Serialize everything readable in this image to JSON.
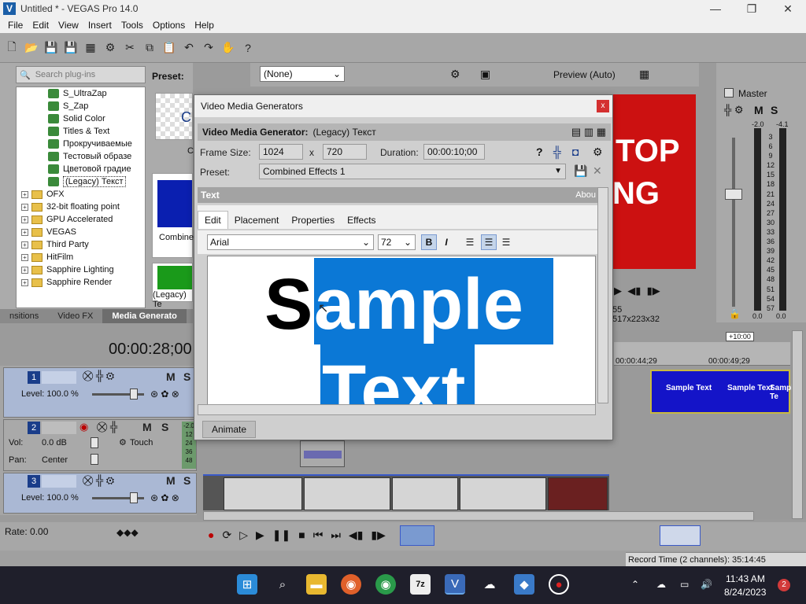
{
  "window": {
    "title": "Untitled * - VEGAS Pro 14.0",
    "logo": "V",
    "minimize": "—",
    "maximize": "❐",
    "close": "✕"
  },
  "menu": [
    "File",
    "Edit",
    "View",
    "Insert",
    "Tools",
    "Options",
    "Help"
  ],
  "plugins": {
    "search_placeholder": "Search plug-ins",
    "preset_label": "Preset:",
    "items": [
      {
        "label": "S_UltraZap",
        "type": "fx"
      },
      {
        "label": "S_Zap",
        "type": "fx"
      },
      {
        "label": "Solid Color",
        "type": "fx"
      },
      {
        "label": "Titles & Text",
        "type": "fx"
      },
      {
        "label": "Прокручиваемые",
        "type": "fx"
      },
      {
        "label": "Тестовый образе",
        "type": "fx"
      },
      {
        "label": "Цветовой градие",
        "type": "fx"
      },
      {
        "label": "(Legacy) Текст",
        "type": "fx"
      },
      {
        "label": "OFX",
        "type": "folder"
      },
      {
        "label": "32-bit floating point",
        "type": "folder"
      },
      {
        "label": "GPU Accelerated",
        "type": "folder"
      },
      {
        "label": "VEGAS",
        "type": "folder"
      },
      {
        "label": "Third Party",
        "type": "folder"
      },
      {
        "label": "HitFilm",
        "type": "folder"
      },
      {
        "label": "Sapphire Lighting",
        "type": "folder"
      },
      {
        "label": "Sapphire Render",
        "type": "folder"
      }
    ],
    "thumb_labels": [
      "C",
      "C",
      "Combined",
      "(Legacy) Te"
    ],
    "tabs": [
      "nsitions",
      "Video FX",
      "Media Generato"
    ]
  },
  "preview": {
    "source": "(None)",
    "mode": "Preview (Auto)",
    "video_text1": "TOP",
    "video_text2": "NG",
    "info1": "55",
    "info2": "517x223x32"
  },
  "master": {
    "label": "Master",
    "mute": "M",
    "solo": "S",
    "levels": [
      "-2.0",
      "-4.1"
    ],
    "scale": [
      "3",
      "6",
      "9",
      "12",
      "15",
      "18",
      "21",
      "24",
      "27",
      "30",
      "33",
      "36",
      "39",
      "42",
      "45",
      "48",
      "51",
      "54",
      "57"
    ],
    "bottom": [
      "0.0",
      "0.0"
    ]
  },
  "timeline": {
    "time": "00:00:28;00",
    "ruler_offset": "+10:00",
    "ruler_times": [
      "00:00:44;29",
      "00:00:49;29"
    ],
    "clip_text": [
      "Sample Text",
      "Sample Text",
      "Sample Te"
    ]
  },
  "tracks": [
    {
      "num": "1",
      "level": "Level: 100.0 %",
      "mute": "M",
      "solo": "S"
    },
    {
      "num": "2",
      "vol": "Vol:",
      "vol_value": "0.0 dB",
      "pan": "Pan:",
      "pan_value": "Center",
      "touch": "Touch",
      "mute": "M",
      "solo": "S",
      "meter": [
        "-2.0",
        "12",
        "24",
        "36",
        "48"
      ]
    },
    {
      "num": "3",
      "level": "Level: 100.0 %",
      "mute": "M",
      "solo": "S"
    }
  ],
  "transport": {
    "rate": "Rate: 0.00",
    "record_time": "Record Time (2 channels): 35:14:45"
  },
  "taskbar": {
    "time": "11:43 AM",
    "date": "8/24/2023",
    "badge": "2"
  },
  "dialog": {
    "title": "Video Media Generators",
    "close": "x",
    "generator_label": "Video Media Generator:",
    "generator_value": "(Legacy) Текст",
    "frame_size_label": "Frame Size:",
    "width": "1024",
    "x": "x",
    "height": "720",
    "duration_label": "Duration:",
    "duration": "00:00:10;00",
    "preset_label": "Preset:",
    "preset": "Combined Effects 1",
    "text_panel": "Text",
    "about": "Abou",
    "tabs": [
      "Edit",
      "Placement",
      "Properties",
      "Effects"
    ],
    "font": "Arial",
    "size": "72",
    "bold": "B",
    "italic": "I",
    "help": "?",
    "sample_first": "S",
    "sample_rest": "ample",
    "sample_line2": "Text",
    "animate": "Animate"
  }
}
